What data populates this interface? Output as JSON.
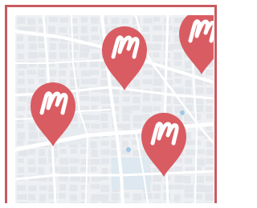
{
  "map": {
    "description_icon": "map-pin-icon",
    "pin_letter": "M",
    "pin_count": 4,
    "colors": {
      "frame": "#c85a5f",
      "pin": "#d95c62",
      "pin_mark": "#ffffff",
      "land": "#eef0f3",
      "block": "#e3e6ea",
      "road": "#ffffff",
      "park": "#dde8f0",
      "water": "#9fc7e4"
    }
  }
}
